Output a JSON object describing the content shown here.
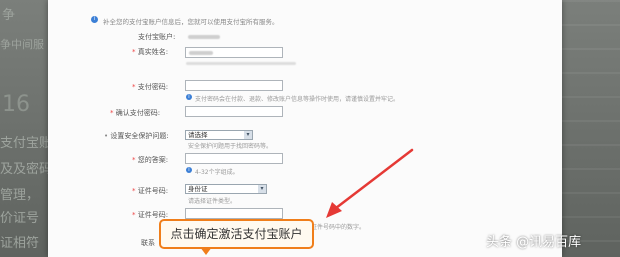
{
  "background": {
    "left_texts": [
      "争",
      "争中间服",
      "16",
      "支付宝账",
      "及及密码",
      "管理，",
      "价证号",
      "证相符"
    ]
  },
  "form": {
    "notice": "补全您的支付宝账户信息后，您就可以使用支付宝所有服务。",
    "account_label": "支付宝账户:",
    "realname_label": "真实姓名:",
    "pay_password_label": "支付密码:",
    "pay_password_hint": "支付密码会在付款、退款、修改账户信息等操作时使用，请谨慎设置并牢记。",
    "confirm_password_label": "确认支付密码:",
    "security_question_label": "设置安全保护问题:",
    "security_question_value": "请选择",
    "security_question_hint": "安全保护问题用于找回密码等。",
    "answer_label": "您的答案:",
    "answer_hint": "4-32个字组成。",
    "id_type_label": "证件号码:",
    "id_type_value": "身份证",
    "id_type_hint": "请选择证件类型。",
    "id_number_label": "证件号码:",
    "id_number_hint": "请输入证件号码中的数字。",
    "contact_label": "联系"
  },
  "annotation": {
    "callout_text": "点击确定激活支付宝账户",
    "arrow_color": "#e53935",
    "callout_border_color": "#f07e1a"
  },
  "watermark": "头条 @讯易百库"
}
